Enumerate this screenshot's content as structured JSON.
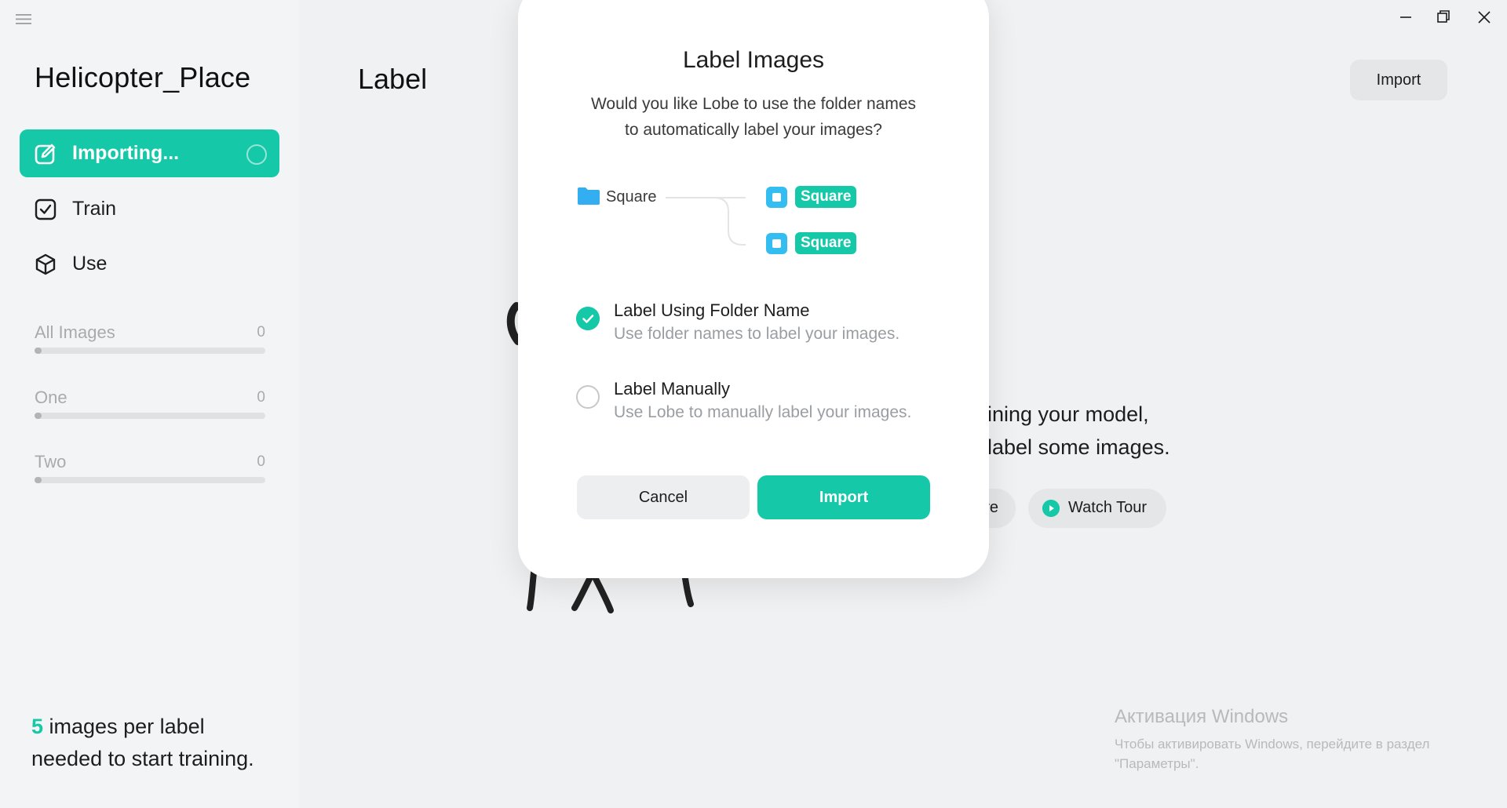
{
  "sidebar": {
    "project_name": "Helicopter_Place",
    "nav": [
      {
        "label": "Importing...",
        "icon": "edit-icon",
        "active": true
      },
      {
        "label": "Train",
        "icon": "checkbox-icon",
        "active": false
      },
      {
        "label": "Use",
        "icon": "cube-icon",
        "active": false
      }
    ],
    "labels": [
      {
        "name": "All Images",
        "count": "0"
      },
      {
        "name": "One",
        "count": "0"
      },
      {
        "name": "Two",
        "count": "0"
      }
    ],
    "hint": {
      "number": "5",
      "text_line1": " images per label",
      "text_line2": "needed to start training."
    }
  },
  "main": {
    "title": "Label",
    "import_button": "Import",
    "intro_line1": "ining your model,",
    "intro_line2": "label some images.",
    "learn_more_fragment": "re",
    "watch_tour": "Watch Tour"
  },
  "modal": {
    "title": "Label Images",
    "description_line1": "Would you like Lobe to use the folder names",
    "description_line2": "to automatically label your images?",
    "diagram": {
      "folder_name": "Square",
      "chip_label": "Square"
    },
    "options": [
      {
        "title": "Label Using Folder Name",
        "description": "Use folder names to label your images.",
        "selected": true
      },
      {
        "title": "Label Manually",
        "description": "Use Lobe to manually label your images.",
        "selected": false
      }
    ],
    "cancel": "Cancel",
    "import": "Import"
  },
  "watermark": {
    "title": "Активация Windows",
    "line1": "Чтобы активировать Windows, перейдите в раздел",
    "line2": "\"Параметры\"."
  },
  "colors": {
    "accent": "#14c8a8",
    "chip_check": "#33bdf0",
    "background": "#f0f1f2"
  }
}
